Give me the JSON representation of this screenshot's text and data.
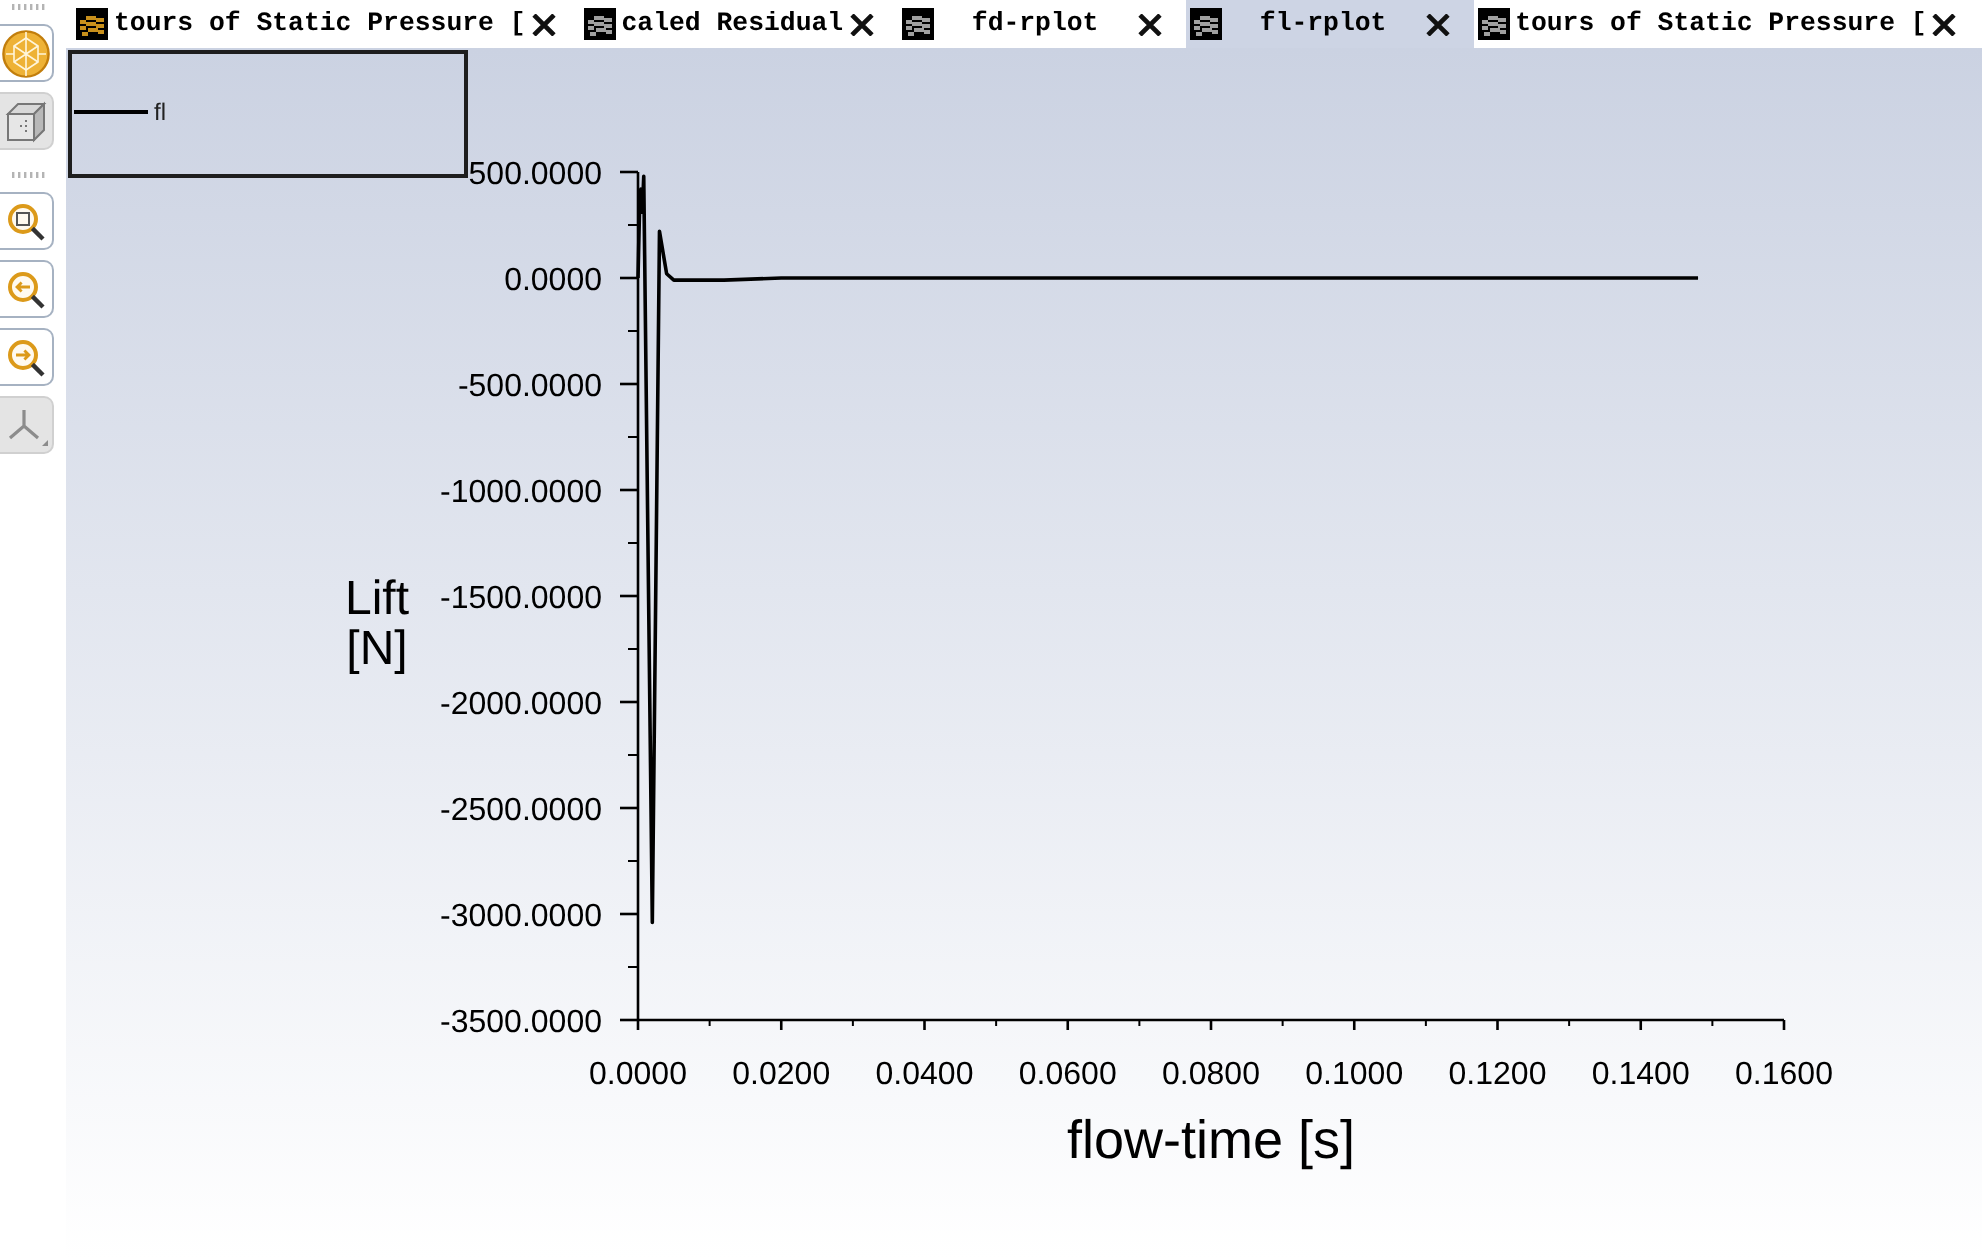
{
  "tabs": [
    {
      "label": "tours of Static Pressure [",
      "color": "#c8901c",
      "selected": false
    },
    {
      "label": "caled Residual",
      "color": "#a0a0a0",
      "selected": false
    },
    {
      "label": "fd-rplot",
      "color": "#a0a0a0",
      "selected": false
    },
    {
      "label": "fl-rplot",
      "color": "#a0a0a0",
      "selected": true
    },
    {
      "label": "tours of Static Pressure [",
      "color": "#a0a0a0",
      "selected": false
    }
  ],
  "toolbar": [
    {
      "disabled": false
    },
    {
      "disabled": true
    },
    {
      "disabled": false
    },
    {
      "disabled": false
    },
    {
      "disabled": false
    },
    {
      "disabled": true
    }
  ],
  "plot": {
    "chart_data": {
      "type": "line",
      "xlabel": "flow-time [s]",
      "ylabel": "Lift [N]",
      "x": [
        0,
        0.0002,
        0.0004,
        0.0006,
        0.0008,
        0.002,
        0.003,
        0.004,
        0.005,
        0.008,
        0.012,
        0.02,
        0.148
      ],
      "series": [
        {
          "name": "fl",
          "color": "#000000",
          "values": [
            0,
            300,
            420,
            310,
            480,
            -3040,
            220,
            20,
            -10,
            -10,
            -10,
            0,
            0
          ]
        }
      ],
      "xlim": [
        0,
        0.16
      ],
      "ylim": [
        -3500,
        500
      ],
      "xticks": [
        {
          "value": 0,
          "label": "0.0000"
        },
        {
          "value": 0.02,
          "label": "0.0200"
        },
        {
          "value": 0.04,
          "label": "0.0400"
        },
        {
          "value": 0.06,
          "label": "0.0600"
        },
        {
          "value": 0.08,
          "label": "0.0800"
        },
        {
          "value": 0.1,
          "label": "0.1000"
        },
        {
          "value": 0.12,
          "label": "0.1200"
        },
        {
          "value": 0.14,
          "label": "0.1400"
        },
        {
          "value": 0.16,
          "label": "0.1600"
        }
      ],
      "yticks": [
        {
          "value": 500,
          "label": "500.0000"
        },
        {
          "value": 0,
          "label": "0.0000"
        },
        {
          "value": -500,
          "label": "-500.0000"
        },
        {
          "value": -1000,
          "label": "-1000.0000"
        },
        {
          "value": -1500,
          "label": "-1500.0000"
        },
        {
          "value": -2000,
          "label": "-2000.0000"
        },
        {
          "value": -2500,
          "label": "-2500.0000"
        },
        {
          "value": -3000,
          "label": "-3000.0000"
        },
        {
          "value": -3500,
          "label": "-3500.0000"
        }
      ]
    }
  }
}
